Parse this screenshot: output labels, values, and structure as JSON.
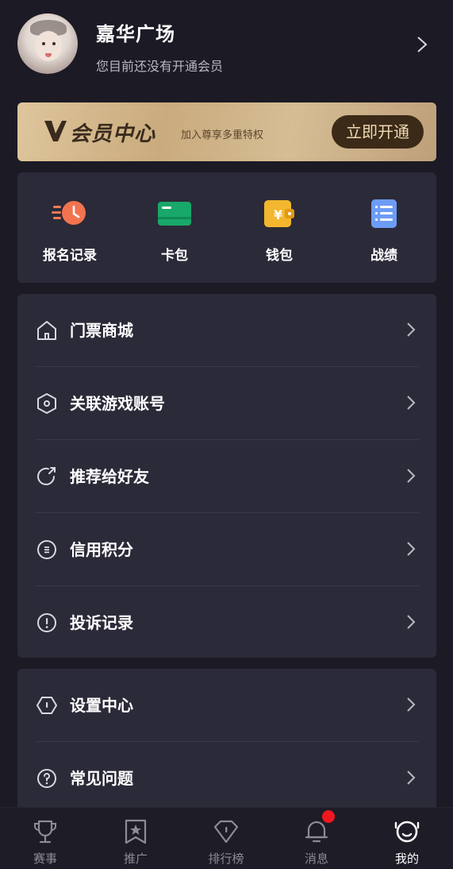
{
  "profile": {
    "nickname": "嘉华广场",
    "member_status": "您目前还没有开通会员"
  },
  "vip_banner": {
    "title": "会员中心",
    "subtitle": "加入尊享多重特权",
    "button_label": "立即开通"
  },
  "quick_actions": [
    {
      "label": "报名记录",
      "icon": "registration-clock-icon"
    },
    {
      "label": "卡包",
      "icon": "card-icon"
    },
    {
      "label": "钱包",
      "icon": "wallet-icon"
    },
    {
      "label": "战绩",
      "icon": "record-list-icon"
    }
  ],
  "menu_group_1": [
    {
      "label": "门票商城",
      "icon": "home-icon"
    },
    {
      "label": "关联游戏账号",
      "icon": "hexagon-link-icon"
    },
    {
      "label": "推荐给好友",
      "icon": "share-refresh-icon"
    },
    {
      "label": "信用积分",
      "icon": "credit-icon"
    },
    {
      "label": "投诉记录",
      "icon": "alert-icon"
    }
  ],
  "menu_group_2": [
    {
      "label": "设置中心",
      "icon": "settings-icon"
    },
    {
      "label": "常见问题",
      "icon": "question-icon"
    }
  ],
  "tabbar": {
    "active": "我的",
    "items": [
      {
        "label": "赛事",
        "icon": "trophy-icon"
      },
      {
        "label": "推广",
        "icon": "bookmark-star-icon"
      },
      {
        "label": "排行榜",
        "icon": "diamond-icon"
      },
      {
        "label": "消息",
        "icon": "bell-icon",
        "has_badge": true
      },
      {
        "label": "我的",
        "icon": "profile-face-icon"
      }
    ]
  },
  "colors": {
    "background": "#1b1a25",
    "card": "#2b2a38",
    "vip_gold": "#d6bd94",
    "vip_button": "#3c2a18",
    "badge": "#f0181e"
  }
}
